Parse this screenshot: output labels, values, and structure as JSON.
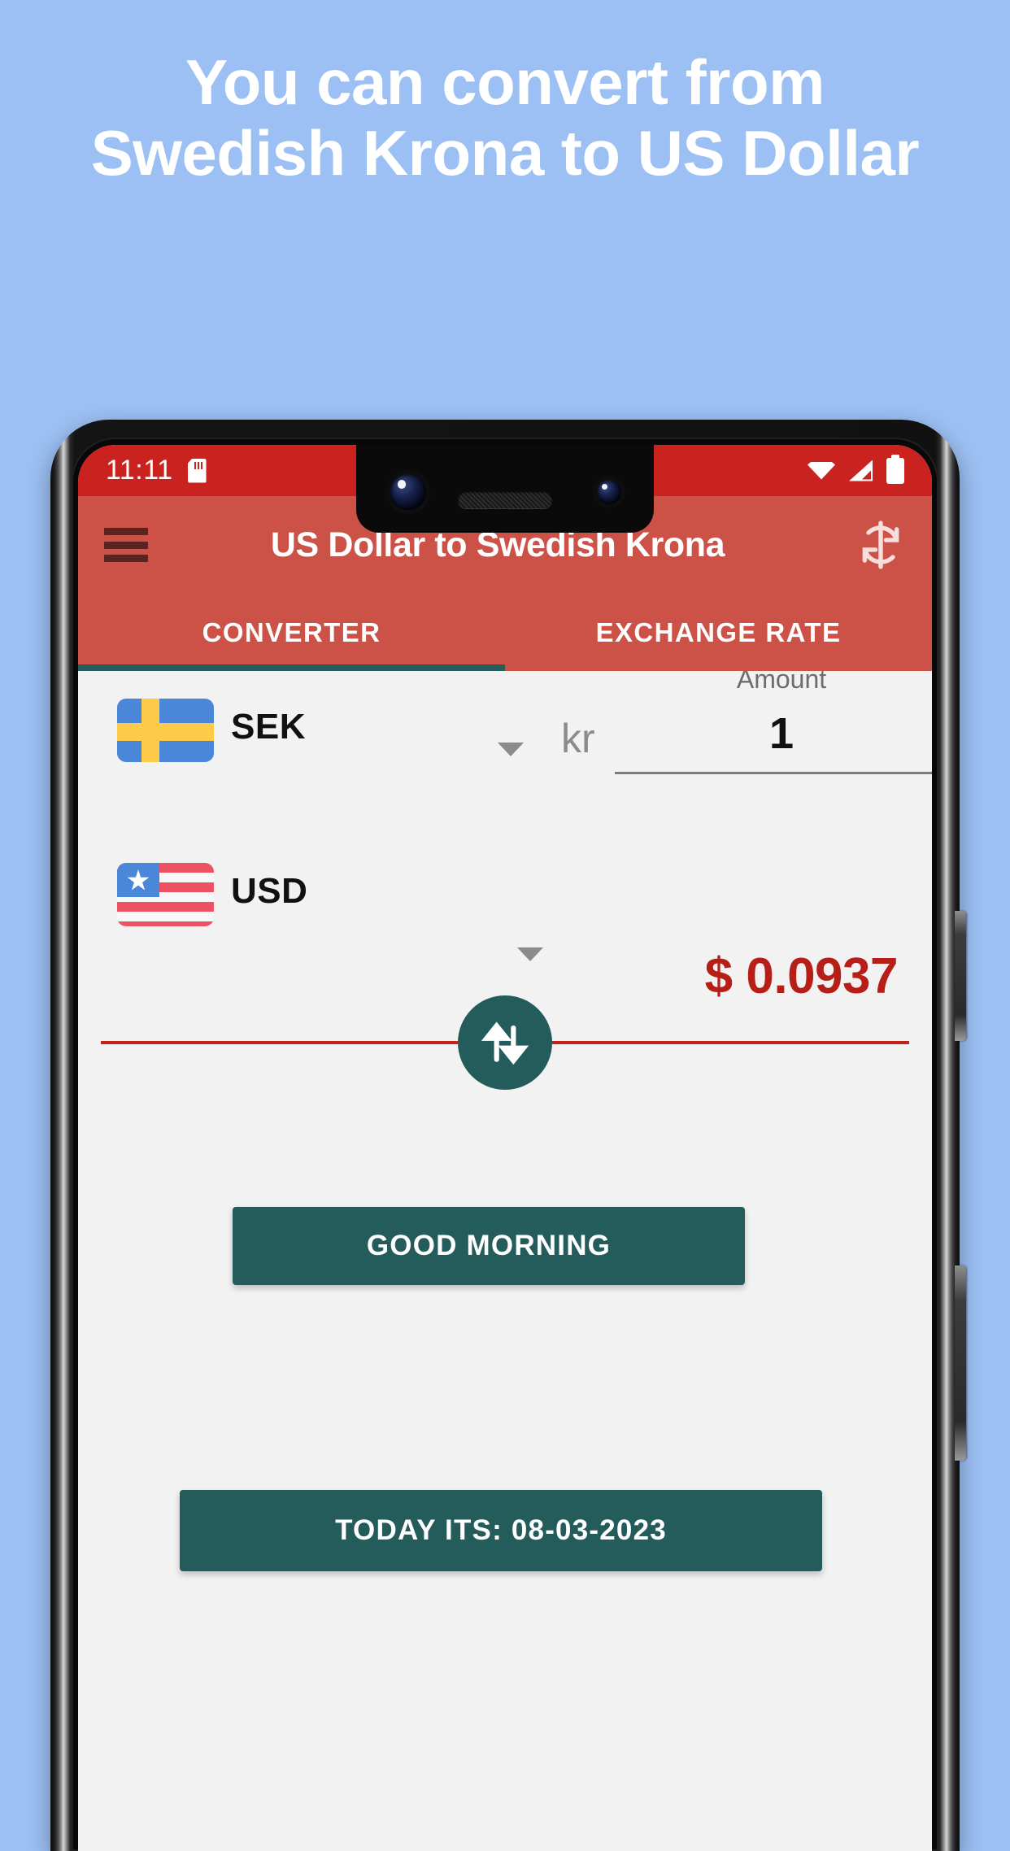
{
  "promo": {
    "headline": "You can convert from Swedish Krona to US Dollar"
  },
  "colors": {
    "background": "#9cc0f3",
    "status_bar": "#c9221f",
    "app_bar": "#cc5147",
    "accent_teal": "#245c5c",
    "result_red": "#b81e18",
    "screen_bg": "#f2f2f2"
  },
  "status_bar": {
    "time": "11:11",
    "sd_card_icon": "sd-card-icon",
    "wifi_icon": "wifi-icon",
    "signal_icon": "signal-icon",
    "battery_icon": "battery-icon"
  },
  "app_bar": {
    "menu_icon": "hamburger-menu-icon",
    "title": "US Dollar to Swedish Krona",
    "refresh_icon": "refresh-sync-icon"
  },
  "tabs": [
    {
      "label": "CONVERTER",
      "active": true
    },
    {
      "label": "EXCHANGE RATE",
      "active": false
    }
  ],
  "converter": {
    "from": {
      "flag": "swedish-flag-icon",
      "code": "SEK",
      "symbol": "kr",
      "amount_label": "Amount",
      "amount_value": "1"
    },
    "to": {
      "flag": "us-flag-icon",
      "code": "USD",
      "converted_value": "$ 0.0937"
    },
    "swap_icon": "swap-up-down-arrows-icon"
  },
  "buttons": {
    "greeting": "GOOD MORNING",
    "date": "TODAY ITS: 08-03-2023"
  },
  "device": {
    "power_button": "power-button",
    "volume_button": "volume-rocker-button",
    "front_camera_main": "front-camera-main",
    "front_camera_secondary": "front-camera-secondary",
    "earpiece": "earpiece-speaker"
  }
}
